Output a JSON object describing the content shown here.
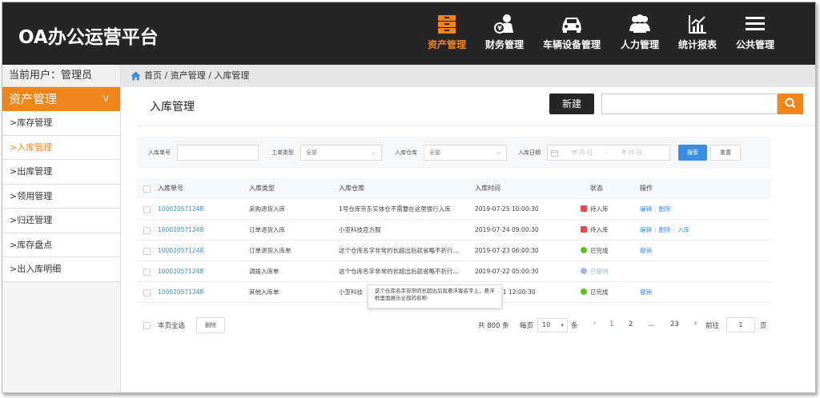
{
  "app": {
    "title": "OA办公运营平台"
  },
  "nav": [
    {
      "label": "资产管理",
      "icon": "asset-icon",
      "active": true
    },
    {
      "label": "财务管理",
      "icon": "finance-icon",
      "active": false
    },
    {
      "label": "车辆设备管理",
      "icon": "car-icon",
      "active": false
    },
    {
      "label": "人力管理",
      "icon": "people-icon",
      "active": false
    },
    {
      "label": "统计报表",
      "icon": "chart-icon",
      "active": false
    },
    {
      "label": "公共管理",
      "icon": "menu-icon",
      "active": false
    }
  ],
  "sidebar": {
    "current_user": "当前用户：管理员",
    "section": "资产管理",
    "section_chevron": "V",
    "items": [
      {
        "label": ">库存管理",
        "active": false
      },
      {
        "label": ">入库管理",
        "active": true
      },
      {
        "label": ">出库管理",
        "active": false
      },
      {
        "label": ">领用管理",
        "active": false
      },
      {
        "label": ">归还管理",
        "active": false
      },
      {
        "label": ">库存盘点",
        "active": false
      },
      {
        "label": ">出入库明细",
        "active": false
      }
    ]
  },
  "breadcrumb": "首页 / 资产管理 / 入库管理",
  "page": {
    "title": "入库管理",
    "new_button": "新建",
    "search_placeholder": ""
  },
  "filters": {
    "order_no_label": "入库单号",
    "order_no_value": "",
    "type_label": "工单类型",
    "type_value": "全部",
    "warehouse_label": "入库仓库",
    "warehouse_value": "全部",
    "date_label": "入库日期",
    "date_start": "年-月-日",
    "date_sep": "-",
    "date_end": "年-月-日",
    "search_button": "搜索",
    "reset_button": "重置"
  },
  "table": {
    "headers": [
      "入库单号",
      "入库类型",
      "入库仓库",
      "入库时间",
      "状态",
      "操作"
    ],
    "rows": [
      {
        "no": "100020571248",
        "type": "采购退货入库",
        "warehouse": "1号仓库京东实体仓不需要在这里换行入库",
        "time": "2019-07-25 10:00:30",
        "status": "待入库",
        "status_color": "#e8474c",
        "ops": [
          "编辑",
          "删除"
        ]
      },
      {
        "no": "100020571248",
        "type": "订单退货入库",
        "warehouse": "小亚科技官方服",
        "time": "2019-07-24 09:00:30",
        "status": "待入库",
        "status_color": "#e8474c",
        "ops": [
          "编辑",
          "删除",
          "入库"
        ]
      },
      {
        "no": "100020571248",
        "type": "订单退货入库单",
        "warehouse": "这个仓库名字非常的长超出后就省略不折行…",
        "time": "2019-07-23 06:00:30",
        "status": "已完成",
        "status_color": "#52c41a",
        "ops": [
          "撤销"
        ]
      },
      {
        "no": "100020571248",
        "type": "调拨入库单",
        "warehouse": "这个仓库名字非常的长超出后就省略不折行…",
        "time": "2019-07-22 05:00:30",
        "status": "已撤销",
        "status_color": "#9bbce6",
        "ops": []
      },
      {
        "no": "100020571248",
        "type": "其他入库单",
        "warehouse": "小亚科技",
        "time": "21 12:00:30",
        "status": "已完成",
        "status_color": "#52c41a",
        "ops": [
          "撤销"
        ]
      }
    ],
    "tooltip": "这个仓库名字非常的长超出后就悬浮客名字上，悬浮框里面展示全部的名称"
  },
  "footer": {
    "select_all": "本页全选",
    "delete_button": "删除",
    "total": "共 800 条",
    "per_page_label": "每页",
    "per_page_value": "10",
    "per_page_unit": "条",
    "pages": [
      "1",
      "2",
      "...",
      "23"
    ],
    "current_page": "1",
    "goto_label": "前往",
    "goto_value": "1",
    "goto_unit": "页"
  },
  "colors": {
    "accent": "#f08519",
    "header_bg": "#262626",
    "link": "#3a8ee6"
  }
}
